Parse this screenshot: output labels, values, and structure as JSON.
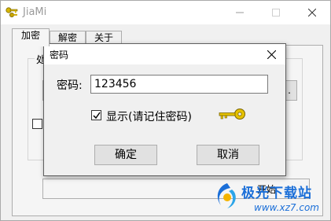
{
  "window": {
    "title": "JiaMi",
    "icon": "key-icon",
    "controls": [
      "minimize-icon",
      "maximize-icon",
      "close-icon"
    ]
  },
  "tabs": [
    {
      "label": "加密",
      "active": true
    },
    {
      "label": "解密",
      "active": false
    },
    {
      "label": "关于",
      "active": false
    }
  ],
  "main": {
    "group_label": "处",
    "button_fragment": ".",
    "start_label": "开始"
  },
  "dialog": {
    "title": "密码",
    "password_label": "密码:",
    "password_value": "123456",
    "show_checkbox_label": "显示(请记住密码)",
    "show_checked": true,
    "ok_label": "确定",
    "cancel_label": "取消"
  },
  "watermark": {
    "title": "极光下载站",
    "url": "www.xz7.com"
  },
  "colors": {
    "accent": "#1b6fd8",
    "key": "#d8b800"
  }
}
